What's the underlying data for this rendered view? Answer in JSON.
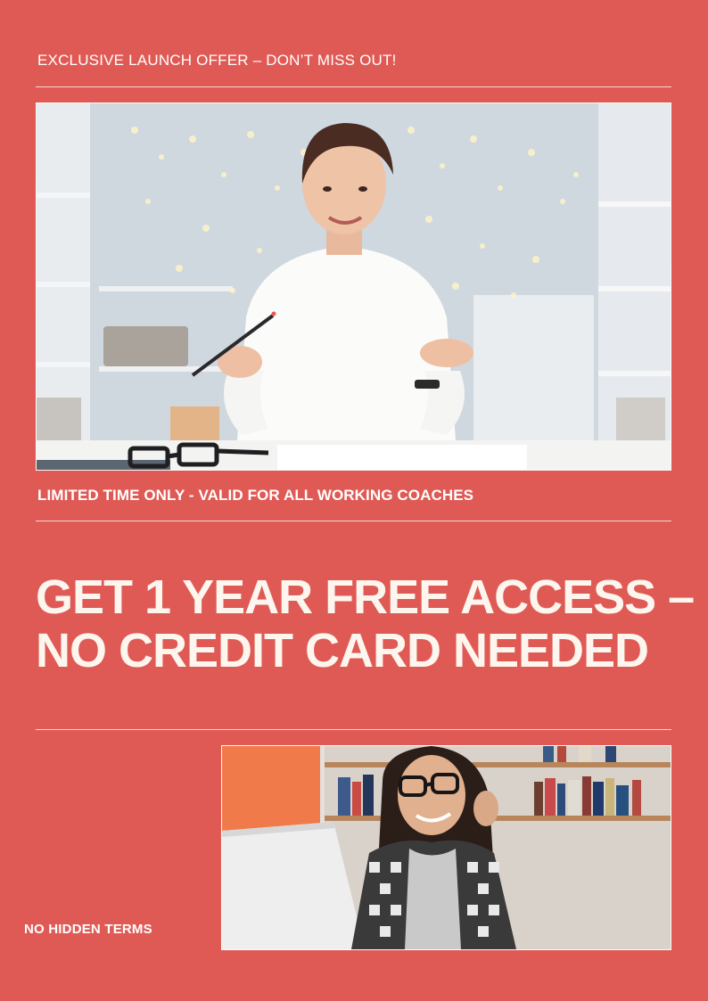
{
  "header": {
    "offer_text": "EXCLUSIVE LAUNCH OFFER – DON’T MISS OUT!"
  },
  "subheader": {
    "limited_text": "LIMITED TIME ONLY - VALID FOR ALL WORKING COACHES"
  },
  "headline": {
    "line1": "GET 1 YEAR FREE ACCESS –",
    "line2": "NO CREDIT CARD NEEDED"
  },
  "footer": {
    "note": "NO HIDDEN TERMS"
  },
  "colors": {
    "background": "#e05a55",
    "text": "#ffffff",
    "headline": "#fdf6ee"
  }
}
